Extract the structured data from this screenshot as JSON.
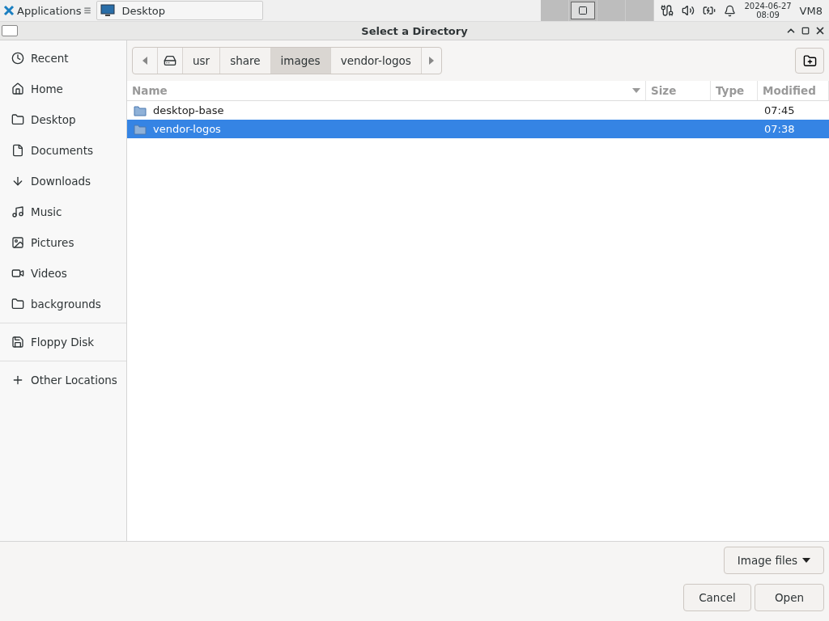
{
  "taskbar": {
    "menu_label": "Applications",
    "task": "Desktop",
    "workspaces": [
      {
        "selected": false
      },
      {
        "selected": true
      },
      {
        "selected": false
      },
      {
        "selected": false
      }
    ],
    "date": "2024-06-27",
    "time": "08:09",
    "user": "VM8"
  },
  "window": {
    "title": "Select a Directory"
  },
  "sidebar": {
    "groups": [
      [
        {
          "label": "Recent"
        },
        {
          "label": "Home"
        },
        {
          "label": "Desktop"
        },
        {
          "label": "Documents"
        },
        {
          "label": "Downloads"
        },
        {
          "label": "Music"
        },
        {
          "label": "Pictures"
        },
        {
          "label": "Videos"
        },
        {
          "label": "backgrounds"
        }
      ],
      [
        {
          "label": "Floppy Disk"
        }
      ],
      [
        {
          "label": "Other Locations"
        }
      ]
    ]
  },
  "path_bar": {
    "segments": [
      {
        "label": "usr",
        "selected": false
      },
      {
        "label": "share",
        "selected": false
      },
      {
        "label": "images",
        "selected": true
      },
      {
        "label": "vendor-logos",
        "selected": false
      }
    ]
  },
  "table": {
    "columns": [
      "Name",
      "Size",
      "Type",
      "Modified"
    ],
    "rows": [
      {
        "name": "desktop-base",
        "size": "",
        "type": "",
        "modified": "07:45",
        "selected": false
      },
      {
        "name": "vendor-logos",
        "size": "",
        "type": "",
        "modified": "07:38",
        "selected": true
      }
    ]
  },
  "filter": {
    "label": "Image files"
  },
  "buttons": [
    "Cancel",
    "Open"
  ]
}
